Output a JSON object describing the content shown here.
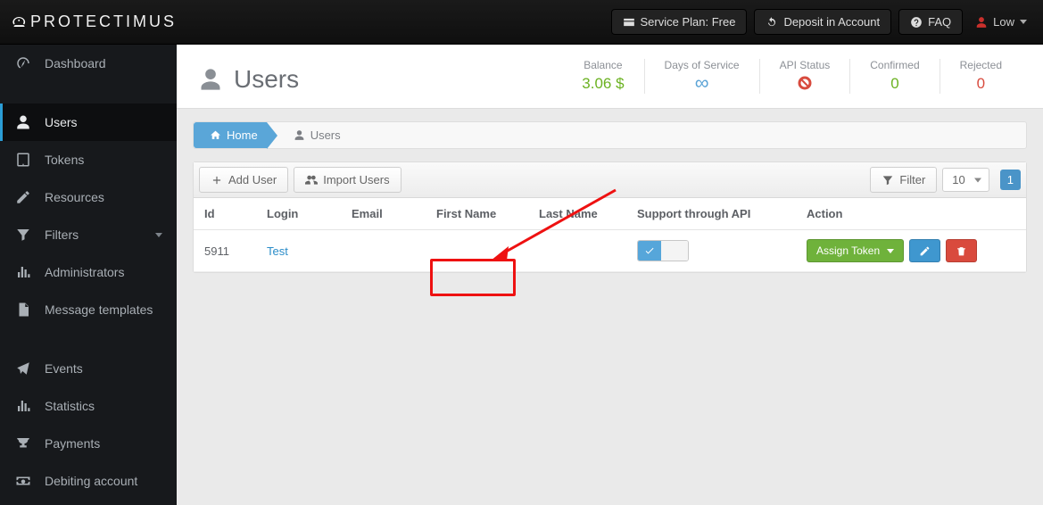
{
  "topbar": {
    "service_plan_label": "Service Plan: Free",
    "deposit_label": "Deposit in Account",
    "faq_label": "FAQ",
    "user_label": "Low"
  },
  "brand": {
    "name": "PROTECTIMUS"
  },
  "sidebar": {
    "items": [
      {
        "label": "Dashboard"
      },
      {
        "label": "Users"
      },
      {
        "label": "Tokens"
      },
      {
        "label": "Resources"
      },
      {
        "label": "Filters"
      },
      {
        "label": "Administrators"
      },
      {
        "label": "Message templates"
      },
      {
        "label": "Events"
      },
      {
        "label": "Statistics"
      },
      {
        "label": "Payments"
      },
      {
        "label": "Debiting account"
      }
    ]
  },
  "page": {
    "title": "Users",
    "stats": {
      "balance_label": "Balance",
      "balance_value": "3.06 $",
      "days_label": "Days of Service",
      "api_label": "API Status",
      "confirmed_label": "Confirmed",
      "confirmed_value": "0",
      "rejected_label": "Rejected",
      "rejected_value": "0"
    },
    "crumbs": {
      "home": "Home",
      "current": "Users"
    }
  },
  "toolbar": {
    "add_label": "Add User",
    "import_label": "Import Users",
    "filter_label": "Filter",
    "page_size": "10",
    "page_num": "1"
  },
  "table": {
    "headers": {
      "id": "Id",
      "login": "Login",
      "email": "Email",
      "first": "First Name",
      "last": "Last Name",
      "api": "Support through API",
      "action": "Action"
    },
    "rows": [
      {
        "id": "5911",
        "login": "Test",
        "email": "",
        "first": "",
        "last": "",
        "api_on": true
      }
    ]
  },
  "actions": {
    "assign_label": "Assign Token"
  }
}
